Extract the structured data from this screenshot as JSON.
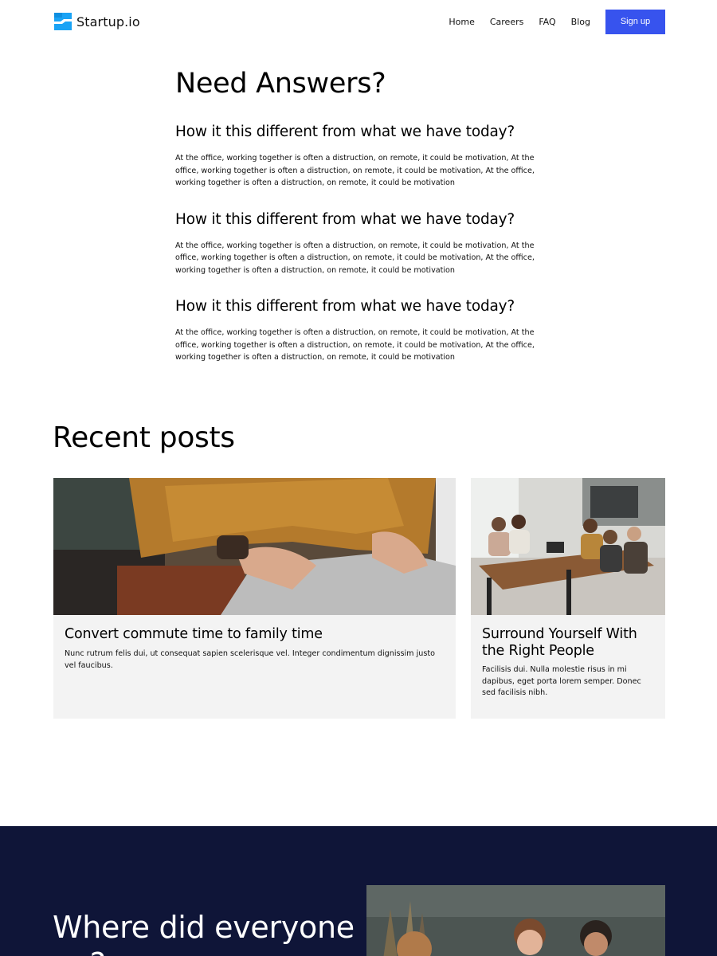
{
  "header": {
    "brand": "Startup.io",
    "nav": [
      "Home",
      "Careers",
      "FAQ",
      "Blog"
    ],
    "signup_label": "Sign up",
    "accent": "#3753ee",
    "logo_color": "#1aa3f5"
  },
  "faq": {
    "title": "Need Answers?",
    "items": [
      {
        "question": "How it this different from what we have today?",
        "answer": "At the office, working together is often a distruction, on remote, it could be motivation, At the office, working together is often a distruction, on remote, it could be motivation, At the office, working together is often a distruction, on remote, it could be motivation"
      },
      {
        "question": "How it this different from what we have today?",
        "answer": "At the office, working together is often a distruction, on remote, it could be motivation, At the office, working together is often a distruction, on remote, it could be motivation, At the office, working together is often a distruction, on remote, it could be motivation"
      },
      {
        "question": "How it this different from what we have today?",
        "answer": "At the office, working together is often a distruction, on remote, it could be motivation, At the office, working together is often a distruction, on remote, it could be motivation, At the office, working together is often a distruction, on remote, it could be motivation"
      }
    ]
  },
  "posts": {
    "title": "Recent posts",
    "items": [
      {
        "title": "Convert commute time to family time",
        "text": "Nunc rutrum felis dui, ut consequat sapien scelerisque vel. Integer condimentum dignissim justo vel faucibus."
      },
      {
        "title": "Surround Yourself With the Right People",
        "text": "Facilisis dui. Nulla molestie risus in mi dapibus, eget porta lorem semper. Donec sed facilisis nibh."
      }
    ]
  },
  "cta": {
    "title": "Where did everyone go?",
    "background": "#0f1538"
  }
}
